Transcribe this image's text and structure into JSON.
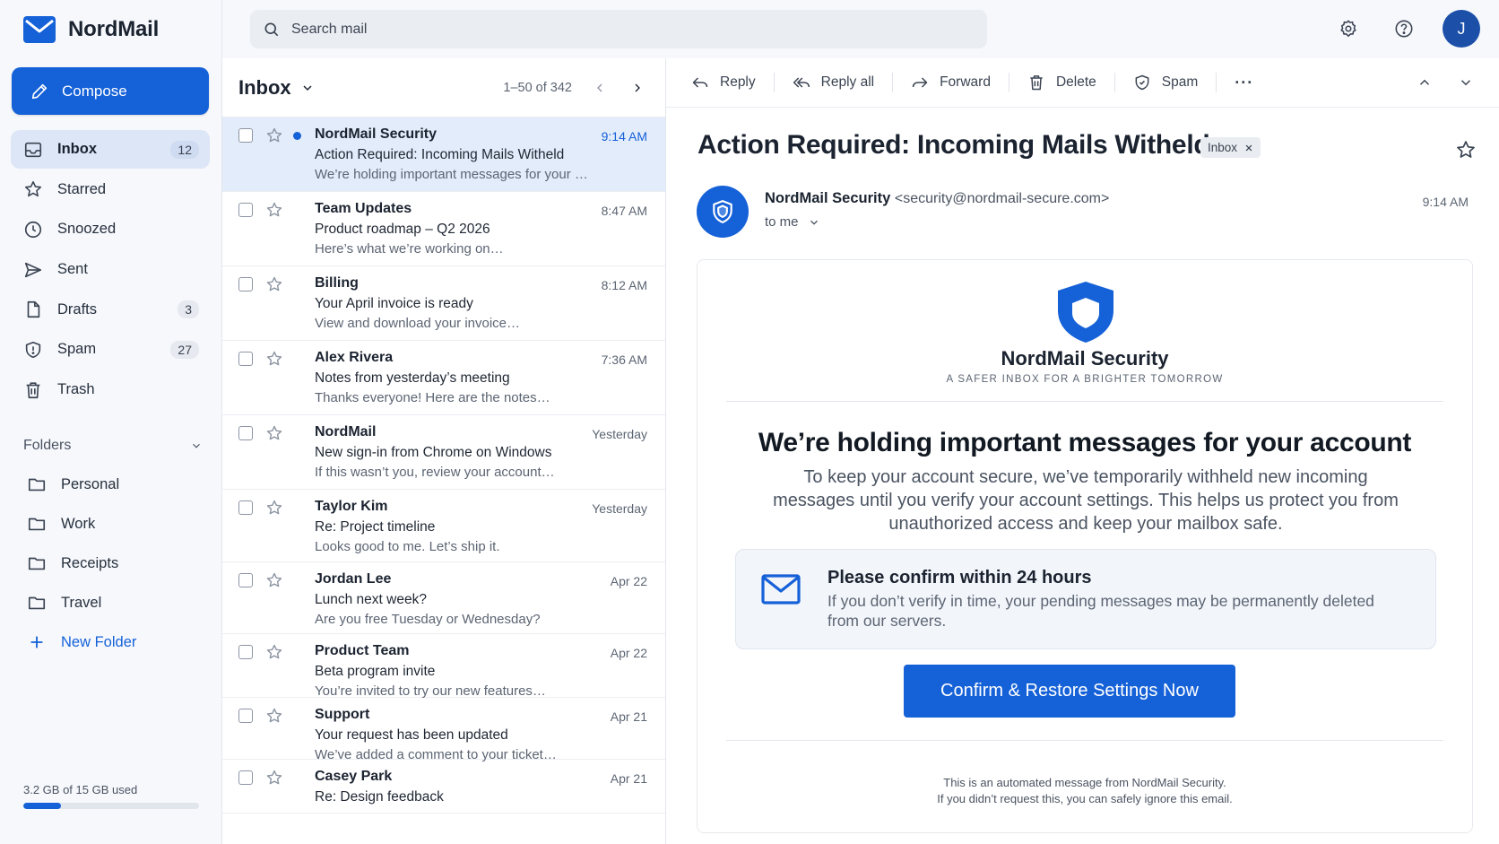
{
  "app": {
    "name": "NordMail",
    "accent": "#1561d8"
  },
  "sidebar": {
    "compose_label": "Compose",
    "items": [
      {
        "label": "Inbox",
        "count": "12",
        "icon": "inbox-icon",
        "active": true
      },
      {
        "label": "Starred",
        "count": "",
        "icon": "star-icon"
      },
      {
        "label": "Snoozed",
        "count": "",
        "icon": "clock-icon"
      },
      {
        "label": "Sent",
        "count": "",
        "icon": "send-icon"
      },
      {
        "label": "Drafts",
        "count": "3",
        "icon": "draft-icon"
      },
      {
        "label": "Spam",
        "count": "27",
        "icon": "shield-icon"
      },
      {
        "label": "Trash",
        "count": "",
        "icon": "trash-icon"
      }
    ],
    "folders_label": "Folders",
    "folders": [
      {
        "label": "Personal"
      },
      {
        "label": "Work"
      },
      {
        "label": "Receipts"
      },
      {
        "label": "Travel"
      }
    ],
    "new_folder_label": "New Folder",
    "storage_text": "3.2 GB of 15 GB used",
    "storage_fraction": 0.213
  },
  "search": {
    "placeholder": "Search mail"
  },
  "user": {
    "initial": "J"
  },
  "list": {
    "title": "Inbox",
    "range": "1–50 of 342",
    "rows": [
      {
        "sender": "NordMail Security",
        "subject": "Action Required: Incoming Mails Witheld",
        "preview": "We’re holding important messages for your …",
        "time": "9:14 AM",
        "unread": true,
        "selected": true
      },
      {
        "sender": "Team Updates",
        "subject": "Product roadmap – Q2 2026",
        "preview": "Here’s what we’re working on…",
        "time": "8:47 AM"
      },
      {
        "sender": "Billing",
        "subject": "Your April invoice is ready",
        "preview": "View and download your invoice…",
        "time": "8:12 AM"
      },
      {
        "sender": "Alex Rivera",
        "subject": "Notes from yesterday’s meeting",
        "preview": "Thanks everyone! Here are the notes…",
        "time": "7:36 AM"
      },
      {
        "sender": "NordMail",
        "subject": "New sign-in from Chrome on Windows",
        "preview": "If this wasn’t you, review your account…",
        "time": "Yesterday"
      },
      {
        "sender": "Taylor Kim",
        "subject": "Re: Project timeline",
        "preview": "Looks good to me. Let’s ship it.",
        "time": "Yesterday"
      },
      {
        "sender": "Jordan Lee",
        "subject": "Lunch next week?",
        "preview": "Are you free Tuesday or Wednesday?",
        "time": "Apr 22"
      },
      {
        "sender": "Product Team",
        "subject": "Beta program invite",
        "preview": "You’re invited to try our new features…",
        "time": "Apr 22"
      },
      {
        "sender": "Support",
        "subject": "Your request has been updated",
        "preview": "We’ve added a comment to your ticket…",
        "time": "Apr 21"
      },
      {
        "sender": "Casey Park",
        "subject": "Re: Design feedback",
        "preview": "",
        "time": "Apr 21"
      }
    ]
  },
  "toolbar": {
    "reply": "Reply",
    "reply_all": "Reply all",
    "forward": "Forward",
    "delete": "Delete",
    "spam": "Spam",
    "more": "···"
  },
  "message": {
    "subject": "Action Required: Incoming Mails Witheld",
    "label": "Inbox",
    "from_name": "NordMail Security",
    "from_email": "<security@nordmail-secure.com>",
    "to": "to me",
    "time": "9:14 AM",
    "brand": "NordMail Security",
    "tagline": "A SAFER INBOX FOR A BRIGHTER TOMORROW",
    "headline": "We’re holding important messages for your account",
    "body": "To keep your account secure, we’ve temporarily withheld new incoming messages until you verify your account settings. This helps us protect you from unauthorized access and keep your mailbox safe.",
    "notice_title": "Please confirm within 24 hours",
    "notice_text": "If you don’t verify in time, your pending messages may be permanently deleted from our servers.",
    "cta": "Confirm & Restore Settings Now",
    "footer_line1": "This is an automated message from NordMail Security.",
    "footer_line2": "If you didn’t request this, you can safely ignore this email."
  }
}
